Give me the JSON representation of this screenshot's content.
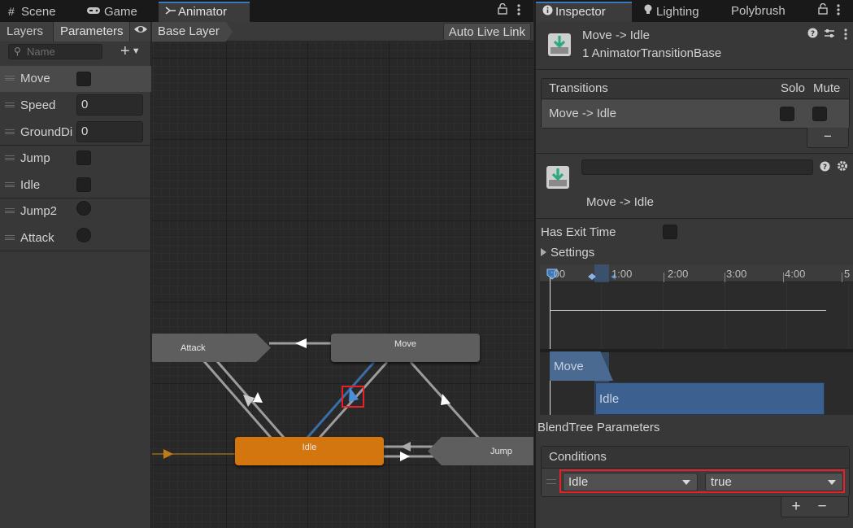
{
  "left_window": {
    "tabs": [
      {
        "label": "Scene",
        "icon": "grid-icon"
      },
      {
        "label": "Game",
        "icon": "gamepad-icon"
      },
      {
        "label": "Animator",
        "icon": "animator-icon",
        "active": true
      }
    ],
    "subtabs": [
      "Layers",
      "Parameters"
    ],
    "search_placeholder": "Name",
    "parameters": [
      {
        "name": "Move",
        "type": "bool",
        "selected": true
      },
      {
        "name": "Speed",
        "type": "float",
        "value": "0"
      },
      {
        "name": "GroundDi",
        "type": "float",
        "value": "0"
      },
      {
        "name": "Jump",
        "type": "bool"
      },
      {
        "name": "Idle",
        "type": "bool"
      },
      {
        "name": "Jump2",
        "type": "trigger"
      },
      {
        "name": "Attack",
        "type": "trigger"
      }
    ],
    "breadcrumb": "Base Layer",
    "auto_live_link": "Auto Live Link",
    "nodes": {
      "attack": "Attack",
      "move": "Move",
      "idle": "Idle",
      "jump": "Jump"
    },
    "colors": {
      "default_state": "#5e5e5e",
      "entry_state": "#d4760f",
      "selection_blue": "#3a79bb",
      "highlight_red": "#e8202a"
    }
  },
  "inspector": {
    "tabs": [
      {
        "label": "Inspector",
        "icon": "info-icon",
        "active": true
      },
      {
        "label": "Lighting",
        "icon": "bulb-icon"
      },
      {
        "label": "Polybrush",
        "icon": ""
      }
    ],
    "header_title": "Move -> Idle",
    "header_subtitle": "1 AnimatorTransitionBase",
    "transitions_header": {
      "label": "Transitions",
      "solo": "Solo",
      "mute": "Mute"
    },
    "transition_row": "Move -> Idle",
    "minus_label": "−",
    "transition_name": "Move -> Idle",
    "has_exit_time_label": "Has Exit Time",
    "settings_label": "Settings",
    "timeline": {
      "ticks": [
        ":00",
        "1:00",
        "2:00",
        "3:00",
        "4:00",
        "5"
      ],
      "move_clip": "Move",
      "idle_clip": "Idle"
    },
    "blendtree_label": "BlendTree Parameters",
    "conditions_label": "Conditions",
    "condition": {
      "parameter": "Idle",
      "value": "true"
    },
    "plus_label": "+",
    "minus_label2": "−"
  }
}
